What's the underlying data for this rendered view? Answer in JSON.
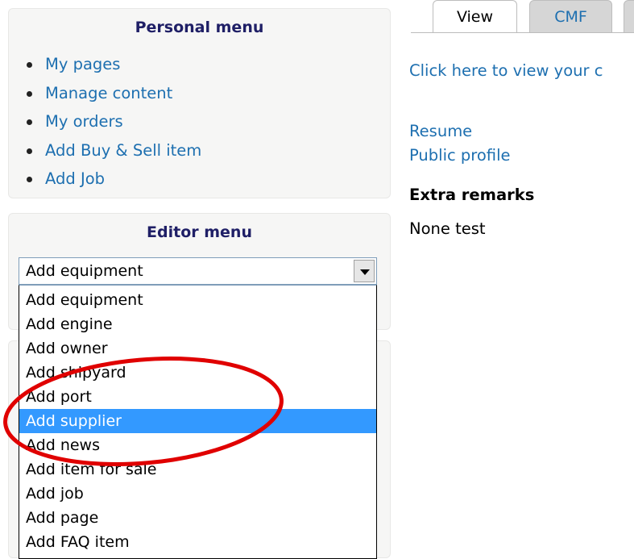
{
  "personal_menu": {
    "title": "Personal menu",
    "items": [
      "My pages",
      "Manage content",
      "My orders",
      "Add Buy & Sell item",
      "Add Job"
    ]
  },
  "editor_menu": {
    "title": "Editor menu",
    "selected_value": "Add equipment",
    "options": [
      "Add equipment",
      "Add engine",
      "Add owner",
      "Add shipyard",
      "Add port",
      "Add supplier",
      "Add news",
      "Add item for sale",
      "Add job",
      "Add page",
      "Add FAQ item"
    ],
    "highlighted_option": "Add supplier"
  },
  "tabs": [
    "View",
    "CMF"
  ],
  "content": {
    "view_link": "Click here to view your c",
    "resume_link": "Resume",
    "public_profile_link": "Public profile",
    "extra_remarks_title": "Extra remarks",
    "extra_remarks_value": "None test"
  },
  "colors": {
    "link": "#1d6fb0",
    "block_title": "#1f1f66",
    "highlight": "#3399ff",
    "annotation": "#e00000"
  }
}
